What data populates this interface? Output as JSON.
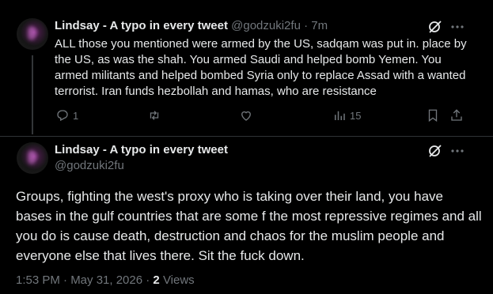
{
  "tweet1": {
    "display_name": "Lindsay - A typo in every tweet",
    "handle": "@godzuki2fu",
    "separator": "·",
    "time_ago": "7m",
    "text": "ALL those you mentioned were armed by the US, sadqam was put in. place by the US, as was the shah. You armed Saudi and helped bomb Yemen. You armed militants and helped bombed Syria only to replace Assad with a wanted terrorist. Iran funds hezbollah and hamas, who are resistance",
    "reply_count": "1",
    "views_count": "15"
  },
  "tweet2": {
    "display_name": "Lindsay - A typo in every tweet",
    "handle": "@godzuki2fu",
    "text": "Groups,  fighting the west's proxy who is taking over their land, you have bases in the gulf countries that are some f the most repressive regimes and all you do is cause death, destruction and chaos for the muslim people and everyone else that lives there. Sit the fuck down.",
    "timestamp": "1:53 PM · May 31, 2026 · ",
    "views_count": "2",
    "views_label": "Views"
  },
  "icons": {
    "grok": "grok-icon",
    "more": "more-icon",
    "reply": "reply-icon",
    "repost": "repost-icon",
    "like": "like-icon",
    "views": "views-icon",
    "bookmark": "bookmark-icon",
    "share": "share-icon"
  },
  "colors": {
    "background": "#000000",
    "text": "#e7e9ea",
    "muted": "#71767b",
    "divider": "#2f3336"
  }
}
